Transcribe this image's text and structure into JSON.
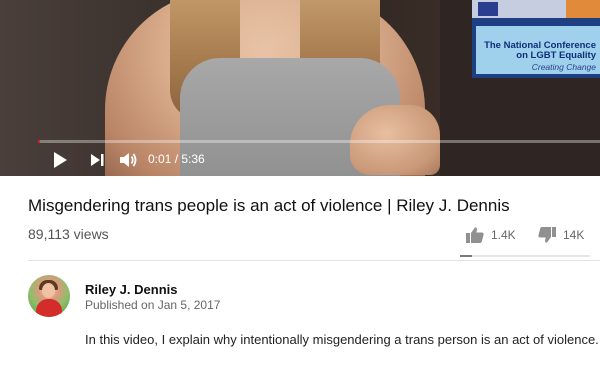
{
  "player": {
    "backdrop_banner": {
      "line1": "The National Conference",
      "line2": "on LGBT Equality",
      "line3": "Creating Change"
    },
    "progress_fraction": 0.003,
    "current_time": "0:01",
    "separator": " / ",
    "duration": "5:36",
    "icons": {
      "play": "play-icon",
      "next": "next-icon",
      "volume": "volume-icon"
    },
    "colors": {
      "progress": "#e62117"
    }
  },
  "video": {
    "title": "Misgendering trans people is an act of violence | Riley J. Dennis",
    "views": "89,113 views",
    "likes": "1.4K",
    "dislikes": "14K",
    "like_fraction": 0.09
  },
  "channel": {
    "name": "Riley J. Dennis",
    "published": "Published on Jan 5, 2017",
    "description": "In this video, I explain why intentionally misgendering a trans person is an act of violence."
  }
}
